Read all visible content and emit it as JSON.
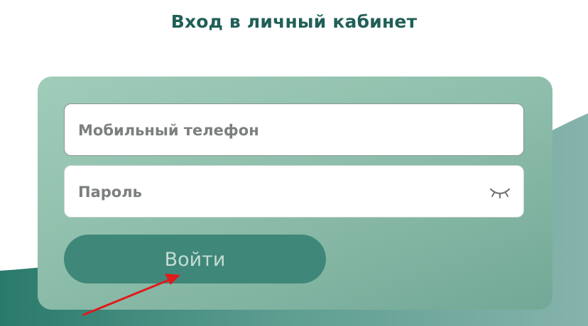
{
  "page": {
    "title": "Вход в личный кабинет"
  },
  "form": {
    "phone_label": "Мобильный телефон",
    "password_label": "Пароль",
    "submit_label": "Войти"
  },
  "icons": {
    "password_toggle": "eye-closed-icon"
  },
  "colors": {
    "title": "#1f5f57",
    "card": "#8fbfac",
    "button": "#3f8779",
    "background_wave": "#2e7a6e",
    "annotation_arrow": "#e01b1b"
  }
}
